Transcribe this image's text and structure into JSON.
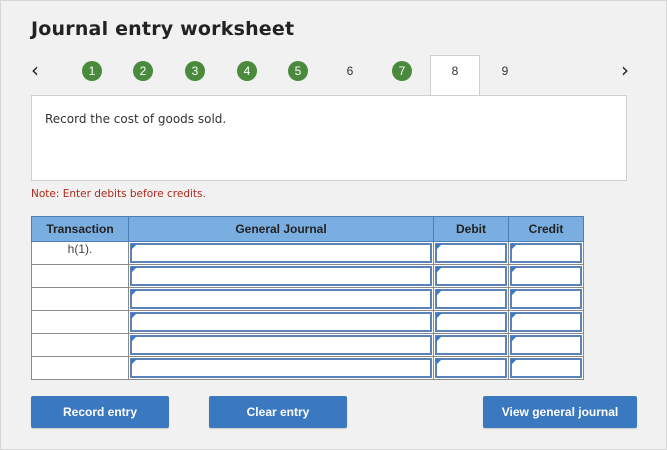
{
  "title": "Journal entry worksheet",
  "nav": {
    "prev_icon": "‹",
    "next_icon": "›",
    "steps": [
      {
        "label": "1",
        "done": true
      },
      {
        "label": "2",
        "done": true
      },
      {
        "label": "3",
        "done": true
      },
      {
        "label": "4",
        "done": true
      },
      {
        "label": "5",
        "done": true
      },
      {
        "label": "6",
        "done": false
      },
      {
        "label": "7",
        "done": true
      },
      {
        "label": "8",
        "active": true
      },
      {
        "label": "9",
        "done": false
      }
    ]
  },
  "instruction": "Record the cost of goods sold.",
  "note": "Note: Enter debits before credits.",
  "table": {
    "headers": [
      "Transaction",
      "General Journal",
      "Debit",
      "Credit"
    ],
    "rows": [
      {
        "transaction": "h(1).",
        "account": "",
        "debit": "",
        "credit": ""
      },
      {
        "transaction": "",
        "account": "",
        "debit": "",
        "credit": ""
      },
      {
        "transaction": "",
        "account": "",
        "debit": "",
        "credit": ""
      },
      {
        "transaction": "",
        "account": "",
        "debit": "",
        "credit": ""
      },
      {
        "transaction": "",
        "account": "",
        "debit": "",
        "credit": ""
      },
      {
        "transaction": "",
        "account": "",
        "debit": "",
        "credit": ""
      }
    ]
  },
  "buttons": {
    "record": "Record entry",
    "clear": "Clear entry",
    "view": "View general journal"
  },
  "colors": {
    "step_done": "#4a8a3d",
    "header": "#7aaee0",
    "button": "#3a78c0",
    "note": "#b0281c"
  }
}
